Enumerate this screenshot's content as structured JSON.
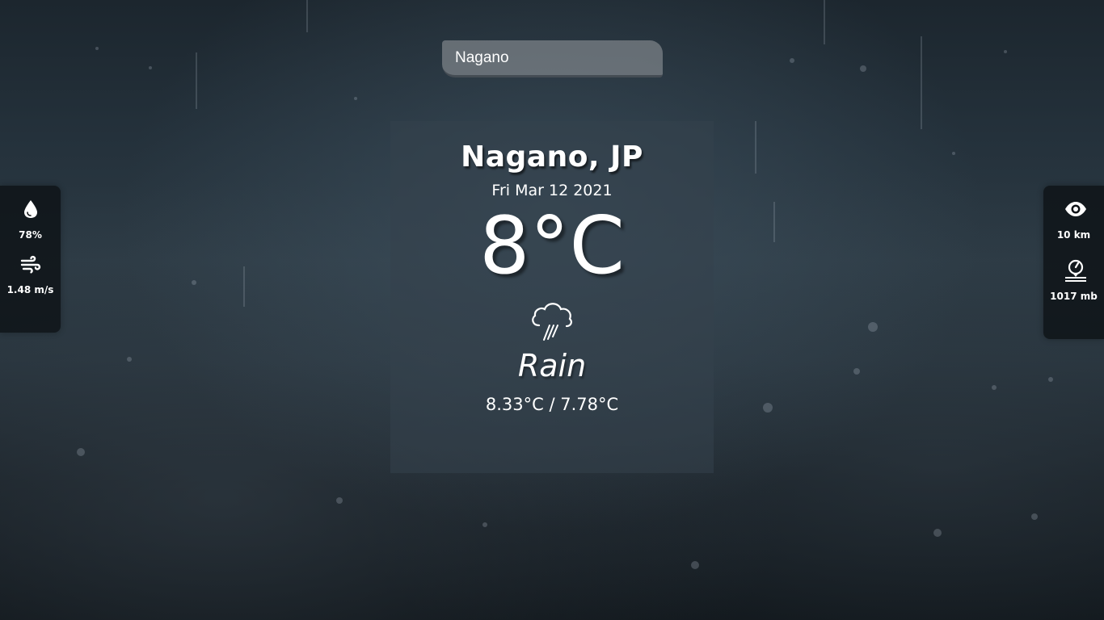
{
  "search": {
    "value": "Nagano"
  },
  "weather": {
    "location": "Nagano, JP",
    "date": "Fri Mar 12 2021",
    "temperature": "8°C",
    "condition_icon": "rain-cloud-icon",
    "condition": "Rain",
    "min_max": "8.33°C / 7.78°C"
  },
  "left_panel": {
    "humidity": {
      "icon": "droplet-icon",
      "value": "78%"
    },
    "wind": {
      "icon": "wind-icon",
      "value": "1.48 m/s"
    }
  },
  "right_panel": {
    "visibility": {
      "icon": "eye-icon",
      "value": "10 km"
    },
    "pressure": {
      "icon": "gauge-icon",
      "value": "1017 mb"
    }
  },
  "colors": {
    "card_bg": "#34424d",
    "panel_bg": "#0e1216",
    "search_bg": "#8c9296",
    "text": "#ffffff"
  }
}
